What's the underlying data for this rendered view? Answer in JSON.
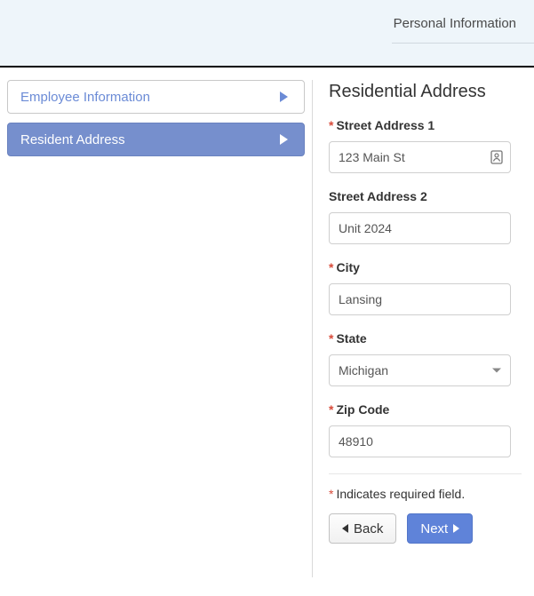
{
  "header": {
    "breadcrumb": "Personal Information"
  },
  "sidebar": {
    "items": [
      {
        "label": "Employee Information",
        "active": false
      },
      {
        "label": "Resident Address",
        "active": true
      }
    ]
  },
  "page": {
    "title": "Residential Address",
    "required_note": "Indicates required field."
  },
  "fields": {
    "street1": {
      "label": "Street Address 1",
      "value": "123 Main St",
      "required": true
    },
    "street2": {
      "label": "Street Address 2",
      "value": "Unit 2024",
      "required": false
    },
    "city": {
      "label": "City",
      "value": "Lansing",
      "required": true
    },
    "state": {
      "label": "State",
      "value": "Michigan",
      "required": true
    },
    "zip": {
      "label": "Zip Code",
      "value": "48910",
      "required": true
    }
  },
  "actions": {
    "back": "Back",
    "next": "Next"
  }
}
